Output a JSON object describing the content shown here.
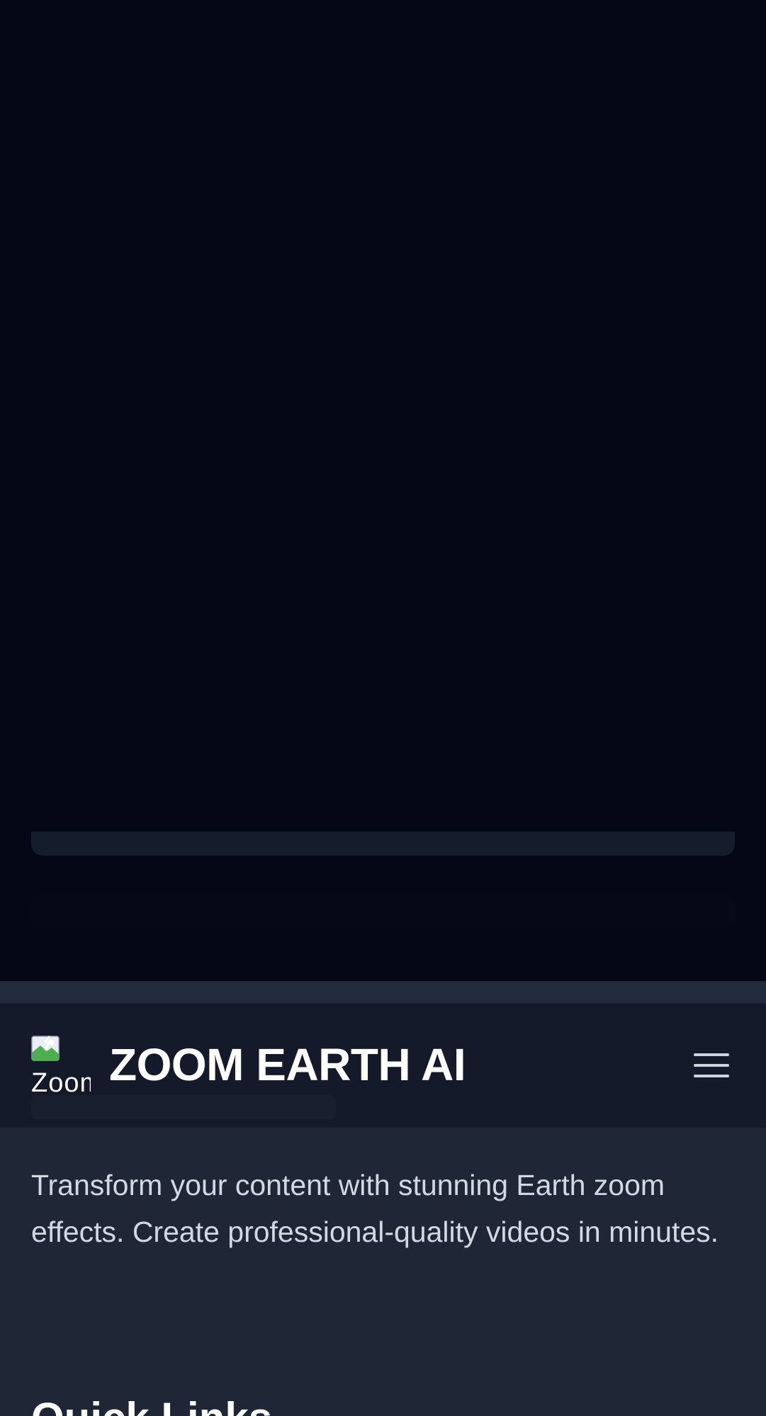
{
  "brand": {
    "name": "ZOOM EARTH AI",
    "logo_alt": "Zoom Earth AI logo"
  },
  "navbar": {
    "menu_icon": "hamburger-menu-icon"
  },
  "footer": {
    "tagline": "Transform your content with stunning Earth zoom effects. Create professional-quality videos in minutes.",
    "quick_links_heading": "Quick Links"
  },
  "colors": {
    "page_background": "#050814",
    "navbar_background": "#141a29",
    "footer_background": "#1f2736",
    "text_primary": "#ffffff",
    "text_secondary": "#d3d9e3"
  }
}
